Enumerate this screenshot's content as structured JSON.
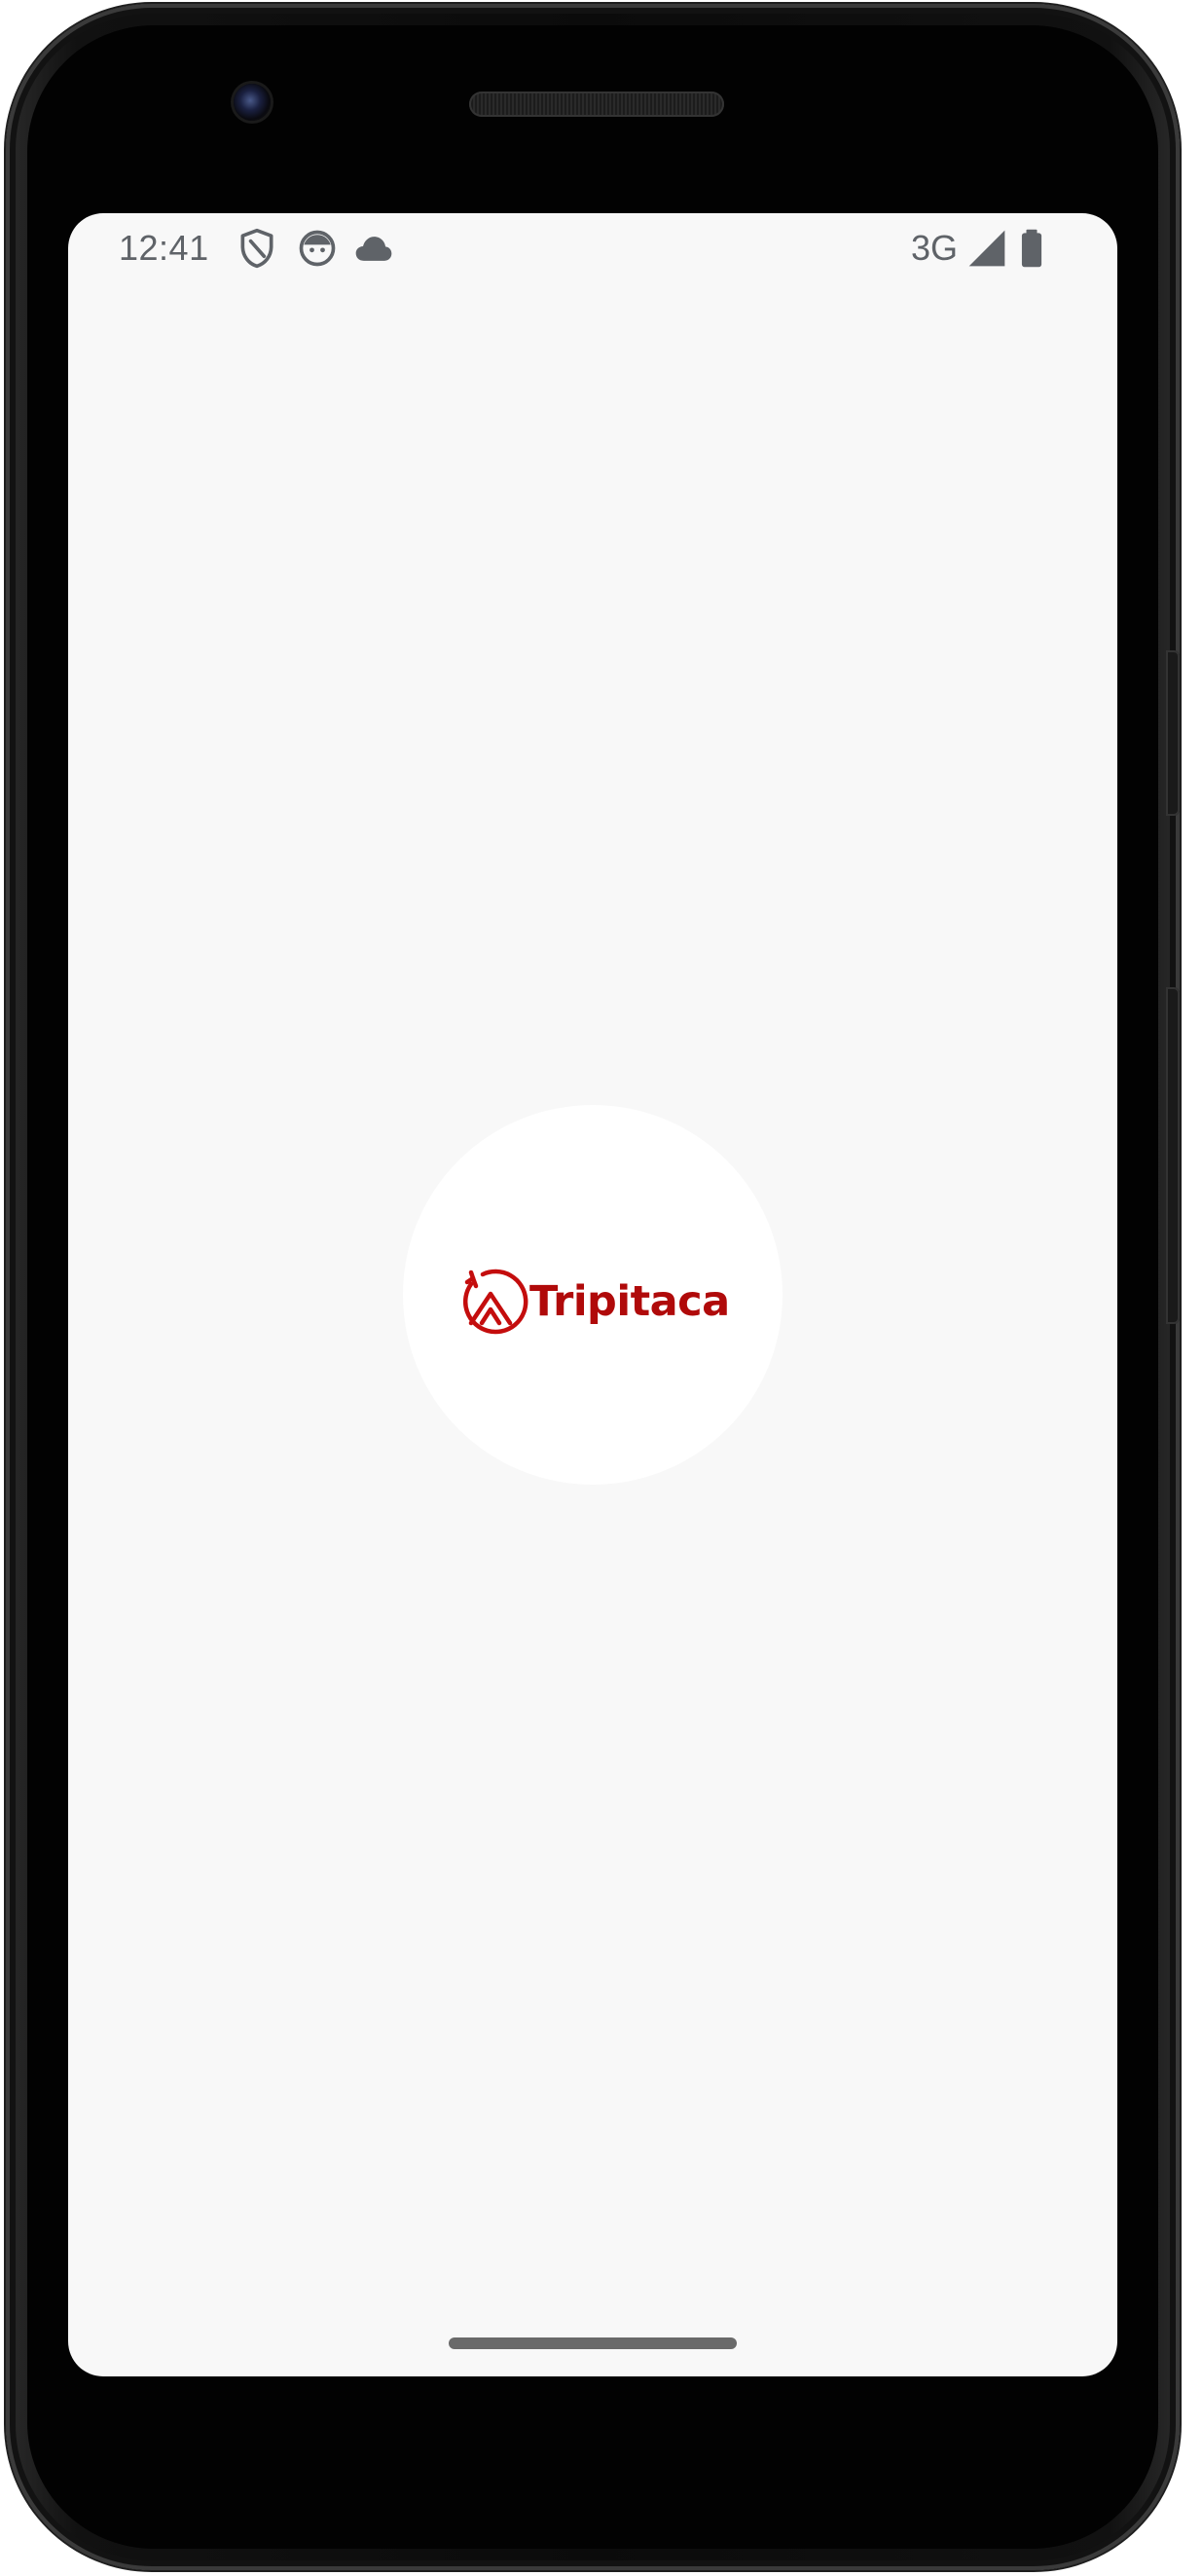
{
  "status_bar": {
    "time": "12:41",
    "network": "3G",
    "icons": [
      "shield-icon",
      "face-icon",
      "cloud-icon",
      "cell-signal-icon",
      "battery-icon"
    ]
  },
  "splash": {
    "brand_name": "Tripitaca",
    "logo_icon": "tripitaca-logo-icon"
  },
  "colors": {
    "brand": "#c40d0d",
    "screen_background": "#f8f8f8",
    "status_text": "#5f6368"
  }
}
